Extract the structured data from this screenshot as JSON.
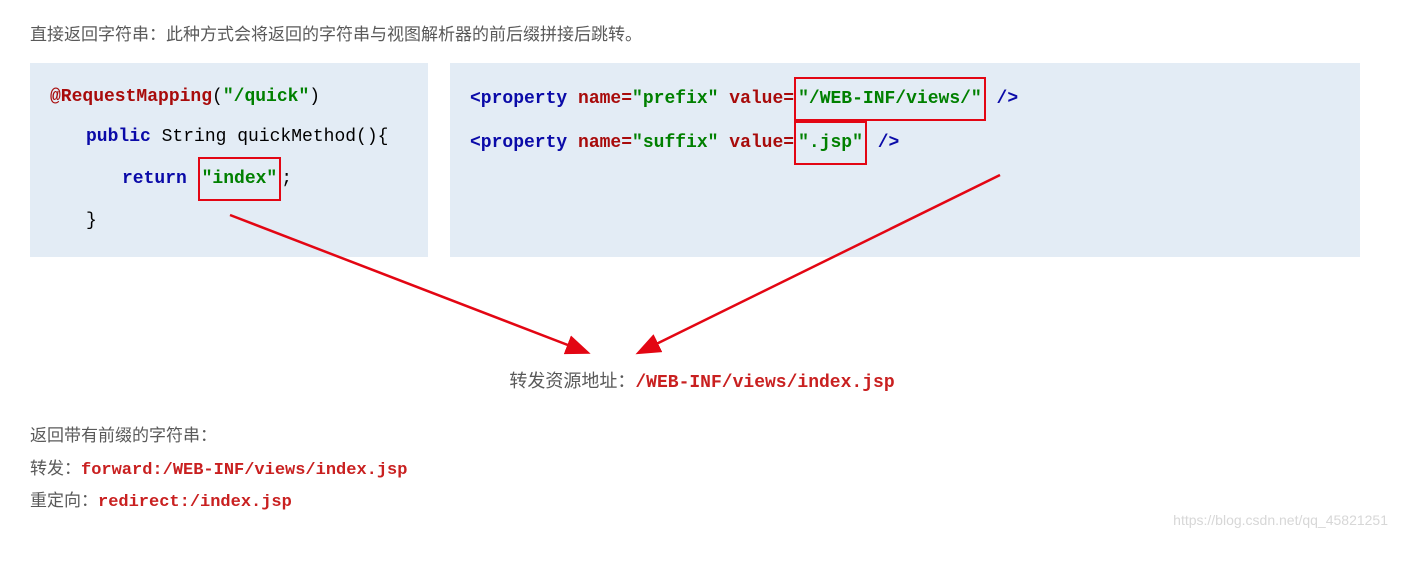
{
  "intro": "直接返回字符串：此种方式会将返回的字符串与视图解析器的前后缀拼接后跳转。",
  "left_code": {
    "anno": "@RequestMapping",
    "anno_arg_open": "(",
    "anno_arg": "\"/quick\"",
    "anno_arg_close": ")",
    "kw_public": "public",
    "type": " String quickMethod(){",
    "kw_return": "return ",
    "ret_val": "\"index\"",
    "semi": ";",
    "close": "}"
  },
  "right_code": {
    "tag_open1": "<property ",
    "attr_name": "name=",
    "val_prefix": "\"prefix\"",
    "attr_value": " value=",
    "val_prefix_path": "\"/WEB-INF/views/\"",
    "tag_close": " />",
    "tag_open2": "<property ",
    "val_suffix": "\"suffix\"",
    "val_suffix_ext": "\".jsp\"",
    "tag_close2": " />"
  },
  "result": {
    "label": "转发资源地址：",
    "path": "/WEB-INF/views/index.jsp"
  },
  "sub_heading": "返回带有前缀的字符串：",
  "forward": {
    "label": "转发：",
    "code": "forward:/WEB-INF/views/index.jsp"
  },
  "redirect": {
    "label": "重定向：",
    "code": "redirect:/index.jsp"
  },
  "watermark": "https://blog.csdn.net/qq_45821251"
}
